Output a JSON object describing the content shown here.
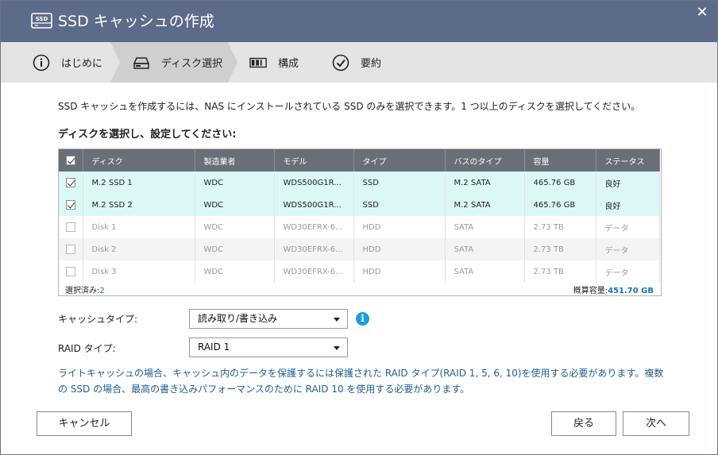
{
  "window": {
    "title": "SSD キャッシュの作成",
    "close_glyph": "✕",
    "title_icon": "ssd-icon",
    "title_icon_text": "SSD"
  },
  "steps": [
    {
      "label": "はじめに",
      "icon": "info-circle-icon",
      "active": false
    },
    {
      "label": "ディスク選択",
      "icon": "disk-drive-icon",
      "active": true
    },
    {
      "label": "構成",
      "icon": "configure-icon",
      "active": false
    },
    {
      "label": "要約",
      "icon": "check-circle-icon",
      "active": false
    }
  ],
  "intro_text": "SSD キャッシュを作成するには、NAS にインストールされている SSD のみを選択できます。1 つ以上のディスクを選択してください。",
  "section_title": "ディスクを選択し、設定してください:",
  "table": {
    "columns": [
      "ディスク",
      "製造業者",
      "モデル",
      "タイプ",
      "バスのタイプ",
      "容量",
      "ステータス"
    ],
    "rows": [
      {
        "checked": true,
        "enabled": true,
        "disk": "M.2 SSD 1",
        "vendor": "WDC",
        "model": "WDS500G1R...",
        "type": "SSD",
        "bus": "M.2 SATA",
        "capacity": "465.76 GB",
        "status": "良好"
      },
      {
        "checked": true,
        "enabled": true,
        "disk": "M.2 SSD 2",
        "vendor": "WDC",
        "model": "WDS500G1R...",
        "type": "SSD",
        "bus": "M.2 SATA",
        "capacity": "465.76 GB",
        "status": "良好"
      },
      {
        "checked": false,
        "enabled": false,
        "disk": "Disk 1",
        "vendor": "WDC",
        "model": "WD30EFRX-6...",
        "type": "HDD",
        "bus": "SATA",
        "capacity": "2.73 TB",
        "status": "データ"
      },
      {
        "checked": false,
        "enabled": false,
        "disk": "Disk 2",
        "vendor": "WDC",
        "model": "WD30EFRX-6...",
        "type": "HDD",
        "bus": "SATA",
        "capacity": "2.73 TB",
        "status": "データ"
      },
      {
        "checked": false,
        "enabled": false,
        "disk": "Disk 3",
        "vendor": "WDC",
        "model": "WD30EFRX-6...",
        "type": "HDD",
        "bus": "SATA",
        "capacity": "2.73 TB",
        "status": "データ"
      }
    ],
    "footer": {
      "selected_label": "選択済み:",
      "selected_value": "2",
      "capacity_label": "概算容量:",
      "capacity_value": "451.70 GB"
    }
  },
  "form": {
    "cache_type_label": "キャッシュタイプ:",
    "cache_type_value": "読み取り/書き込み",
    "raid_type_label": "RAID タイプ:",
    "raid_type_value": "RAID 1",
    "info_glyph": "i"
  },
  "note": "ライトキャッシュの場合、キャッシュ内のデータを保護するには保護された RAID タイプ(RAID 1, 5, 6, 10)を使用する必要があります。複数の SSD の場合、最高の書き込みパフォーマンスのために RAID 10 を使用する必要があります。",
  "buttons": {
    "cancel": "キャンセル",
    "back": "戻る",
    "next": "次へ"
  },
  "colors": {
    "titlebar": "#5d6b8a",
    "steps_bg": "#e4e4e4",
    "selected_row": "#dcf8f6",
    "table_header": "#6a6e78",
    "note_text": "#1f5f8c",
    "info_icon": "#1f9bde"
  }
}
